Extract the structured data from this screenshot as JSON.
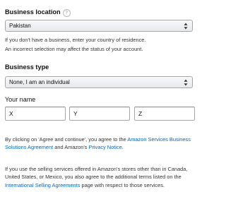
{
  "business_location": {
    "label": "Business location",
    "help_icon": "question-circle-icon",
    "selected": "Pakistan",
    "hint_line1": "If you don't have a business, enter your country of residence.",
    "hint_line2": "An incorrect selection may affect the status of your account."
  },
  "business_type": {
    "label": "Business type",
    "selected": "None, I am an individual"
  },
  "your_name": {
    "label": "Your name",
    "first": "X",
    "middle": "Y",
    "last": "Z"
  },
  "agreement": {
    "text_before": "By clicking on 'Agree and continue', you agree to the ",
    "link1": "Amazon Services Business Solutions Agreement",
    "text_middle": " and Amazon's ",
    "link2": "Privacy Notice",
    "text_end": "."
  },
  "international": {
    "text_before": "If you use the selling services offered in Amazon's stores other than in Canada, United States, or Mexico, you also agree to the additional terms listed on the ",
    "link": "International Selling Agreements",
    "text_after": " page with respect to those services."
  },
  "colors": {
    "link": "#0066c0",
    "border": "#a6a6a6",
    "text": "#111111",
    "select_gradient_top": "#f7f8fa",
    "select_gradient_bottom": "#e7e9ec"
  },
  "icons": {
    "select_arrows": "up-down-chevron-icon"
  }
}
